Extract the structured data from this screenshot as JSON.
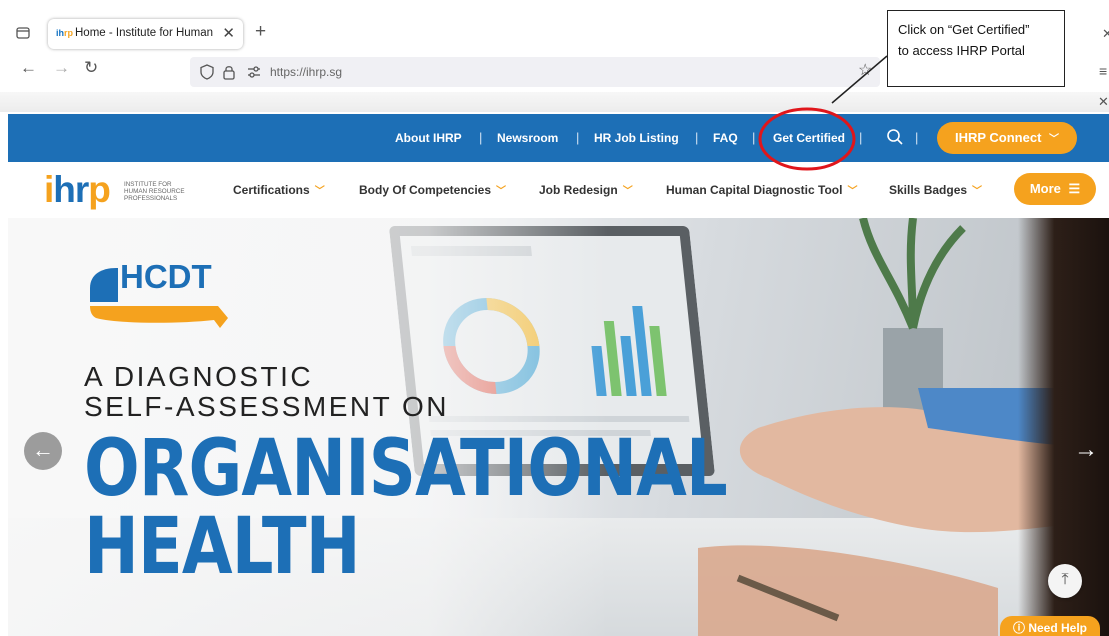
{
  "browser": {
    "tab_title": "Home - Institute for Human Re",
    "tab_favicon": "ihrp",
    "url_host": "https://ihrp.sg",
    "icons": [
      "tab-list-icon",
      "close-icon",
      "plus-icon",
      "back-icon",
      "forward-icon",
      "reload-icon",
      "shield-icon",
      "lock-icon",
      "permissions-icon",
      "star-icon"
    ]
  },
  "topbar": {
    "links": [
      "About IHRP",
      "Newsroom",
      "HR Job Listing",
      "FAQ",
      "Get Certified"
    ],
    "separator": "|",
    "connect_label": "IHRP Connect",
    "accent": "#f5a21e",
    "bar_color": "#1d6fb6"
  },
  "mainnav": {
    "logo_mark": "ihrp",
    "logo_text": [
      "INSTITUTE FOR",
      "HUMAN RESOURCE",
      "PROFESSIONALS"
    ],
    "items": [
      "Certifications",
      "Body Of Competencies",
      "Job Redesign",
      "Human Capital Diagnostic Tool",
      "Skills Badges"
    ],
    "more_label": "More"
  },
  "hero": {
    "badge": "HCDT",
    "line1": "A DIAGNOSTIC",
    "line2": "SELF-ASSESSMENT ON",
    "title1": "ORGANISATIONAL",
    "title2": "HEALTH",
    "need_help": "Need Help"
  },
  "annotation": {
    "text_line1": "Click on “Get Certified”",
    "text_line2": "to access IHRP Portal",
    "highlight_color": "#e0161b"
  }
}
